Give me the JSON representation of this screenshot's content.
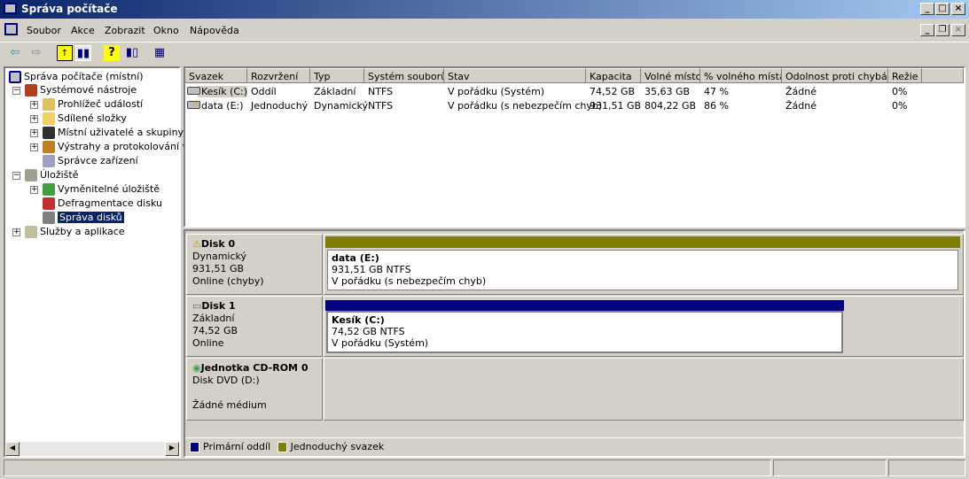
{
  "window": {
    "title": "Správa počítače"
  },
  "menu": [
    "Soubor",
    "Akce",
    "Zobrazit",
    "Okno",
    "Nápověda"
  ],
  "tree": [
    {
      "label": "Správa počítače (místní)",
      "level": 0
    },
    {
      "label": "Systémové nástroje",
      "level": 1,
      "expander": "−"
    },
    {
      "label": "Prohlížeč událostí",
      "level": 2,
      "expander": "+"
    },
    {
      "label": "Sdílené složky",
      "level": 2,
      "expander": "+"
    },
    {
      "label": "Místní uživatelé a skupiny",
      "level": 2,
      "expander": "+"
    },
    {
      "label": "Výstrahy a protokolování vý",
      "level": 2,
      "expander": "+"
    },
    {
      "label": "Správce zařízení",
      "level": 2
    },
    {
      "label": "Úložiště",
      "level": 1,
      "expander": "−"
    },
    {
      "label": "Vyměnitelné úložiště",
      "level": 2,
      "expander": "+"
    },
    {
      "label": "Defragmentace disku",
      "level": 2
    },
    {
      "label": "Správa disků",
      "level": 2,
      "selected": true
    },
    {
      "label": "Služby a aplikace",
      "level": 1,
      "expander": "+"
    }
  ],
  "volumes": {
    "columns": [
      "Svazek",
      "Rozvržení",
      "Typ",
      "Systém souborů",
      "Stav",
      "Kapacita",
      "Volné místo",
      "% volného místa",
      "Odolnost proti chybám",
      "Režie"
    ],
    "rows": [
      [
        "Kesík (C:)",
        "Oddíl",
        "Základní",
        "NTFS",
        "V pořádku (Systém)",
        "74,52 GB",
        "35,63 GB",
        "47 %",
        "Žádné",
        "0%"
      ],
      [
        "data (E:)",
        "Jednoduchý",
        "Dynamický",
        "NTFS",
        "V pořádku (s nebezpečím chyb)",
        "931,51 GB",
        "804,22 GB",
        "86 %",
        "Žádné",
        "0%"
      ]
    ]
  },
  "disks": [
    {
      "name": "Disk 0",
      "type": "Dynamický",
      "size": "931,51 GB",
      "status": "Online (chyby)",
      "partition": {
        "name": "data  (E:)",
        "size": "931,51 GB NTFS",
        "status": "V pořádku (s nebezpečím chyb)",
        "color": "#808000"
      }
    },
    {
      "name": "Disk 1",
      "type": "Základní",
      "size": "74,52 GB",
      "status": "Online",
      "partition": {
        "name": "Kesík  (C:)",
        "size": "74,52 GB NTFS",
        "status": "V pořádku (Systém)",
        "color": "#000080"
      }
    },
    {
      "name": "Jednotka CD-ROM 0",
      "type": "Disk DVD (D:)",
      "status": "Žádné médium"
    }
  ],
  "legend": [
    {
      "label": "Primární oddíl",
      "color": "#000080"
    },
    {
      "label": "Jednoduchý svazek",
      "color": "#808000"
    }
  ]
}
